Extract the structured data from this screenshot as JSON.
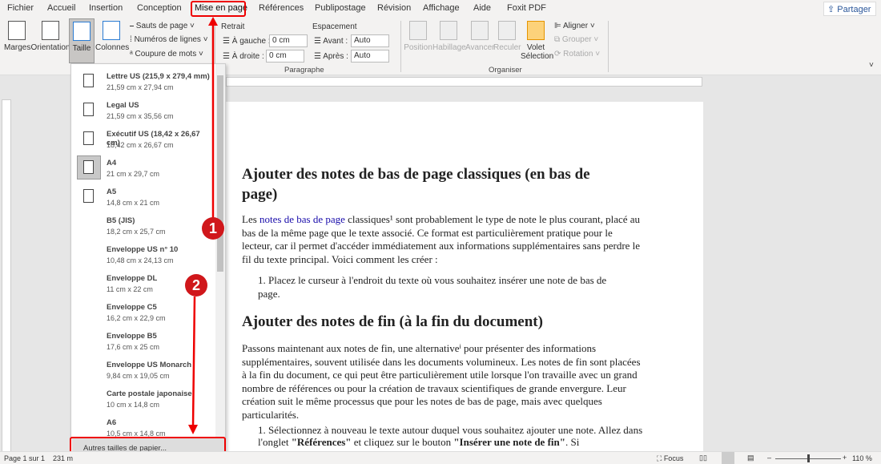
{
  "tabs": [
    "Fichier",
    "Accueil",
    "Insertion",
    "Conception",
    "Mise en page",
    "Références",
    "Publipostage",
    "Révision",
    "Affichage",
    "Aide",
    "Foxit PDF"
  ],
  "share_label": "Partager",
  "ribbon": {
    "marges": "Marges",
    "orientation": "Orientation",
    "taille": "Taille",
    "colonnes": "Colonnes",
    "sauts": "Sauts de page",
    "numeros": "Numéros de lignes",
    "coupure": "Coupure de mots",
    "retrait": "Retrait",
    "espacement": "Espacement",
    "gauche_label": "À gauche :",
    "gauche_value": "0 cm",
    "droite_label": "À droite :",
    "droite_value": "0 cm",
    "avant_label": "Avant :",
    "avant_value": "Auto",
    "apres_label": "Après :",
    "apres_value": "Auto",
    "paragraphe": "Paragraphe",
    "position": "Position",
    "habillage": "Habillage",
    "avancer": "Avancer",
    "reculer": "Reculer",
    "volet1": "Volet",
    "volet2": "Sélection",
    "aligner": "Aligner",
    "grouper": "Grouper",
    "rotation": "Rotation",
    "organiser": "Organiser"
  },
  "sizes": [
    {
      "name": "Lettre US (215,9 x 279,4 mm)",
      "dims": "21,59 cm x 27,94 cm",
      "icon": true
    },
    {
      "name": "Legal US",
      "dims": "21,59 cm x 35,56 cm",
      "icon": true
    },
    {
      "name": "Exécutif US (18,42 x 26,67 cm)",
      "dims": "18,42 cm x 26,67 cm",
      "icon": true
    },
    {
      "name": "A4",
      "dims": "21 cm x 29,7 cm",
      "icon": true,
      "selected": true
    },
    {
      "name": "A5",
      "dims": "14,8 cm x 21 cm",
      "icon": true
    },
    {
      "name": "B5 (JIS)",
      "dims": "18,2 cm x 25,7 cm"
    },
    {
      "name": "Enveloppe US n° 10",
      "dims": "10,48 cm x 24,13 cm"
    },
    {
      "name": "Enveloppe DL",
      "dims": "11 cm x 22 cm"
    },
    {
      "name": "Enveloppe C5",
      "dims": "16,2 cm x 22,9 cm"
    },
    {
      "name": "Enveloppe B5",
      "dims": "17,6 cm x 25 cm"
    },
    {
      "name": "Enveloppe US Monarch",
      "dims": "9,84 cm x 19,05 cm"
    },
    {
      "name": "Carte postale japonaise",
      "dims": "10 cm x 14,8 cm"
    },
    {
      "name": "A6",
      "dims": "10,5 cm x 14,8 cm"
    }
  ],
  "more_sizes": "Autres tailles de papier...",
  "doc": {
    "h1": "Ajouter des notes de bas de page classiques (en bas de page)",
    "p1_pre": "Les ",
    "p1_link": "notes de bas de page",
    "p1_post": " classiques¹ sont probablement le type de note le plus courant, placé au bas de la même page que le texte associé. Ce format est particulièrement pratique pour le lecteur, car il permet d'accéder immédiatement aux informations supplémentaires sans perdre le fil du texte principal. Voici comment les créer :",
    "li1": "1.   Placez le curseur à l'endroit du texte où vous souhaitez insérer une note de bas de page.",
    "h2": "Ajouter des notes de fin (à la fin du document)",
    "p2": "Passons maintenant aux notes de fin, une alternativeⁱ pour présenter des informations supplémentaires, souvent utilisée dans les documents volumineux. Les notes de fin sont placées à la fin du document, ce qui peut être particulièrement utile lorsque l'on travaille avec un grand nombre de références ou pour la création de travaux scientifiques de grande envergure. Leur création suit le même processus que pour les notes de bas de page, mais avec quelques particularités.",
    "li2_a": "1.   Sélectionnez à nouveau le texte autour duquel vous souhaitez ajouter une note. Allez dans l'onglet ",
    "li2_b": "\"Références\"",
    "li2_c": " et cliquez sur le bouton ",
    "li2_d": "\"Insérer une note de fin\"",
    "li2_e": ". Si"
  },
  "status": {
    "page": "Page 1 sur 1",
    "words": "231 m",
    "focus": "Focus",
    "zoom": "110 %"
  },
  "annotations": {
    "step1": "1",
    "step2": "2",
    "color": "#e00000"
  }
}
